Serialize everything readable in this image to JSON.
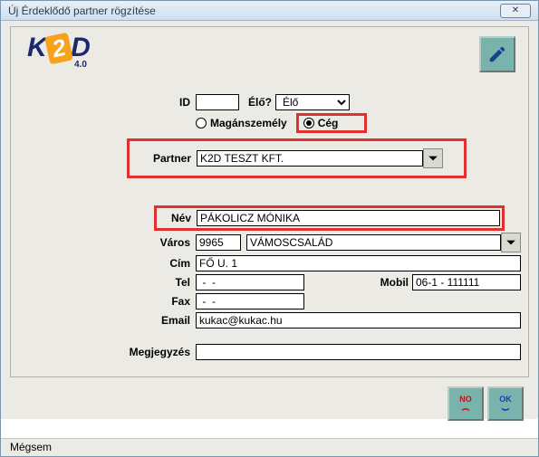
{
  "window": {
    "title": "Új Érdeklődő partner rögzítése"
  },
  "labels": {
    "id": "ID",
    "elo": "Élő?",
    "magan": "Magánszemély",
    "ceg": "Cég",
    "partner": "Partner",
    "nev": "Név",
    "varos": "Város",
    "cim": "Cím",
    "tel": "Tel",
    "mobil": "Mobil",
    "fax": "Fax",
    "email": "Email",
    "megjegyzes": "Megjegyzés"
  },
  "values": {
    "id": "",
    "elo_selected": "Élő",
    "partner_type": "ceg",
    "partner": "K2D TESZT KFT.",
    "nev": "PÁKOLICZ MÓNIKA",
    "varos_zip": "9965",
    "varos_name": "VÁMOSCSALÁD",
    "cim": "FŐ U. 1",
    "tel": " -  - ",
    "mobil": "06-1 - 111111",
    "fax": " -  - ",
    "email": "kukac@kukac.hu",
    "megjegyzes": ""
  },
  "footer": {
    "no": "NO",
    "ok": "OK"
  },
  "status": "Mégsem",
  "logo": {
    "brand": "K",
    "mid": "2",
    "brand2": "D",
    "ver": "4.0"
  }
}
